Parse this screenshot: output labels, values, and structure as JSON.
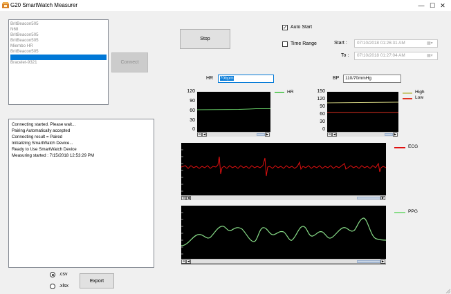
{
  "window": {
    "title": "G20 SmartWatch Measurer",
    "minimize_glyph": "—",
    "maximize_glyph": "☐",
    "close_glyph": "✕"
  },
  "devices": {
    "items": [
      {
        "label": "BritBeacon505",
        "selected": false
      },
      {
        "label": "N68",
        "selected": false
      },
      {
        "label": "BritBeacon505",
        "selected": false
      },
      {
        "label": "BritBeacon505",
        "selected": false
      },
      {
        "label": "Miembo HR",
        "selected": false
      },
      {
        "label": "BritBeacon505",
        "selected": false
      },
      {
        "label": "",
        "selected": true
      },
      {
        "label": "Bracelet-9321",
        "selected": false
      }
    ]
  },
  "buttons": {
    "connect": "Connect",
    "stop": "Stop",
    "export": "Export"
  },
  "log": {
    "lines": [
      "Connecting started. Please wait...",
      "Pairing Automatically accepted",
      "Connecting result = Paired",
      "Initializing SmartWatch Device...",
      "Ready to Use SmartWatch Device",
      "Measuring started : 7/15/2018 12:53:29 PM"
    ]
  },
  "export_format": {
    "options": [
      {
        "label": ".csv",
        "checked": true
      },
      {
        "label": ".xlsx",
        "checked": false
      }
    ]
  },
  "options": {
    "auto_start_label": "Auto Start",
    "auto_start_checked": true,
    "time_range_label": "Time Range",
    "time_range_checked": false
  },
  "time_range": {
    "start_label": "Start :",
    "start_value": "07/10/2018 01:26:31 AM",
    "to_label": "To :",
    "to_value": "07/10/2018 01:27:04 AM"
  },
  "readings": {
    "hr_label": "HR",
    "hr_value": "70bpm",
    "bp_label": "BP",
    "bp_value": "110/70mmHg"
  },
  "hr_chart": {
    "y_ticks": [
      "120",
      "90",
      "60",
      "30",
      "0"
    ],
    "legend": [
      {
        "name": "HR",
        "color": "#66cc66"
      }
    ],
    "value": 68
  },
  "bp_chart": {
    "y_ticks": [
      "150",
      "120",
      "90",
      "60",
      "30",
      "0"
    ],
    "legend": [
      {
        "name": "High",
        "color": "#c8c87a"
      },
      {
        "name": "Low",
        "color": "#e03020"
      }
    ],
    "high": 110,
    "low": 70
  },
  "ecg_chart": {
    "legend": [
      {
        "name": "ECG",
        "color": "#e01010"
      }
    ]
  },
  "ppg_chart": {
    "legend": [
      {
        "name": "PPG",
        "color": "#66cc66"
      }
    ]
  },
  "colors": {
    "selection": "#0078d7",
    "chart_bg": "#000000"
  }
}
